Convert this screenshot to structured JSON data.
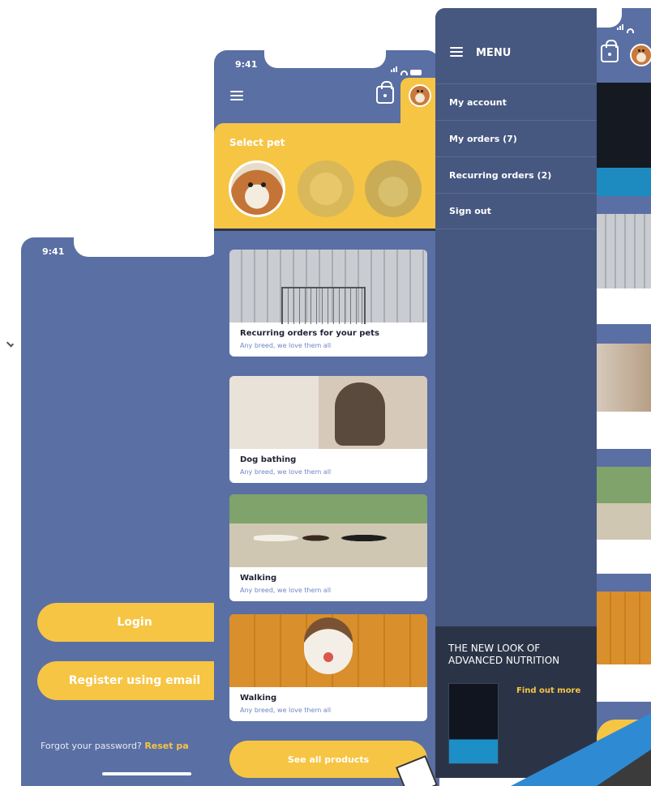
{
  "screen_login": {
    "time": "9:41",
    "login_label": "Login",
    "register_label": "Register using email",
    "forgot_text": "Forgot your password?",
    "reset_text": "Reset pa"
  },
  "screen_home": {
    "time": "9:41",
    "select_pet_label": "Select pet",
    "cards": [
      {
        "title": "Recurring orders for your pets",
        "subtitle": "Any breed, we love them all"
      },
      {
        "title": "Dog bathing",
        "subtitle": "Any breed, we love them all"
      },
      {
        "title": "Walking",
        "subtitle": "Any breed, we love them all"
      },
      {
        "title": "Walking",
        "subtitle": "Any breed, we love them all"
      }
    ],
    "see_all_label": "See all products"
  },
  "screen_menu": {
    "menu_title": "MENU",
    "items": [
      {
        "label": "My account"
      },
      {
        "label": "My orders (7)"
      },
      {
        "label": "Recurring orders (2)"
      },
      {
        "label": "Sign out"
      }
    ],
    "promo": {
      "headline": "THE NEW LOOK OF ADVANCED NUTRITION",
      "cta": "Find out more"
    }
  },
  "colors": {
    "primary_blue": "#5a6fa3",
    "drawer": "#465780",
    "accent_yellow": "#f6c544",
    "promo_dark": "#2b3447"
  },
  "icons": [
    "hamburger-icon",
    "shopping-bag-icon",
    "signal-icon",
    "wifi-icon",
    "battery-icon"
  ]
}
